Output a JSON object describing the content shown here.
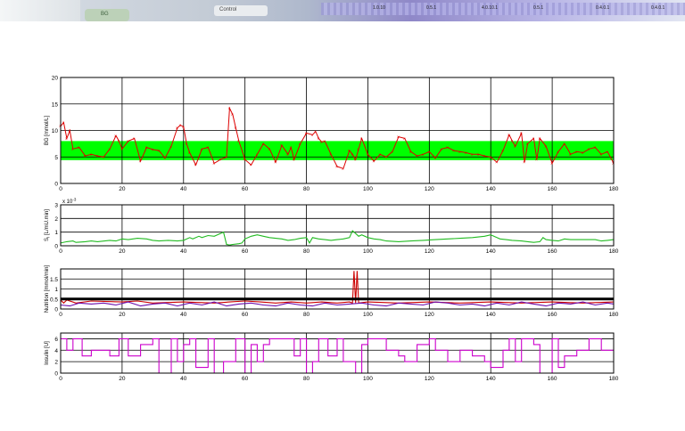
{
  "colors": {
    "background": "#ffffff",
    "band": "#00ff00",
    "bg_series": "#dd0000",
    "si_series": "#22bb22",
    "nutrition_series": "#cc0000",
    "nutrition_series2": "#6a0dad",
    "insulin_series": "#cc00cc",
    "axis": "#000000"
  },
  "banner": {
    "tile_text": "BG",
    "tile2_text": "Control",
    "strip_labels": [
      "1.0.10",
      "0.5.1",
      "4.0.10.1",
      "0.5.1",
      "0.4.0.1",
      "0.4.0.1"
    ]
  },
  "chart_data": [
    {
      "type": "line",
      "ylabel": "BG [mmol/L]",
      "xlim": [
        0,
        180
      ],
      "ylim": [
        0,
        20
      ],
      "xticks": [
        "0",
        "20",
        "40",
        "60",
        "80",
        "100",
        "120",
        "140",
        "160",
        "180"
      ],
      "yticks": [
        "0",
        "5",
        "10",
        "15",
        "20"
      ],
      "band": [
        4.4,
        8.0
      ],
      "series": [
        {
          "x": [
            0,
            1,
            2,
            3,
            4,
            6,
            8,
            10,
            12,
            14,
            16,
            18,
            19,
            20,
            22,
            24,
            26,
            28,
            30,
            32,
            34,
            36,
            38,
            39,
            40,
            41,
            42,
            44,
            46,
            48,
            50,
            52,
            54,
            55,
            56,
            57,
            58,
            60,
            62,
            64,
            66,
            68,
            70,
            72,
            74,
            75,
            76,
            78,
            80,
            82,
            83,
            84,
            85,
            86,
            88,
            90,
            92,
            94,
            95,
            96,
            97,
            98,
            100,
            102,
            104,
            106,
            108,
            110,
            112,
            114,
            116,
            118,
            120,
            122,
            124,
            126,
            128,
            130,
            132,
            134,
            136,
            138,
            140,
            142,
            144,
            146,
            147,
            148,
            150,
            151,
            152,
            154,
            155,
            156,
            158,
            160,
            162,
            164,
            166,
            168,
            170,
            172,
            174,
            176,
            178,
            180
          ],
          "y": [
            10.8,
            11.5,
            8.5,
            10,
            6.5,
            6.8,
            5.2,
            5.5,
            5.2,
            5.0,
            6.5,
            9.0,
            8.0,
            6.5,
            8.0,
            8.5,
            4.2,
            6.8,
            6.4,
            6.2,
            4.8,
            7.0,
            10.5,
            11.0,
            10.7,
            7.5,
            5.8,
            3.5,
            6.5,
            6.8,
            3.8,
            4.5,
            5.0,
            14.2,
            13.0,
            10.5,
            8.0,
            4.5,
            3.5,
            5.5,
            7.5,
            6.5,
            4.0,
            7.2,
            5.5,
            6.8,
            4.5,
            7.5,
            9.5,
            9.2,
            9.8,
            8.5,
            7.8,
            8.0,
            5.5,
            3.2,
            2.8,
            6.2,
            5.5,
            4.5,
            6.5,
            8.5,
            5.5,
            4.2,
            5.5,
            5.0,
            6.0,
            8.8,
            8.5,
            6.0,
            5.2,
            5.5,
            6.0,
            4.8,
            6.5,
            6.8,
            6.2,
            6.0,
            5.8,
            5.5,
            5.5,
            5.2,
            5.0,
            4.0,
            6.2,
            9.2,
            8.0,
            7.0,
            9.5,
            4.0,
            7.5,
            8.5,
            4.5,
            8.5,
            7.0,
            3.8,
            6.0,
            7.5,
            5.5,
            6.0,
            5.8,
            6.5,
            6.8,
            5.5,
            6.0,
            3.8
          ]
        }
      ]
    },
    {
      "type": "line",
      "ylabel": "S",
      "ylabel_sub": "I",
      "ylabel_rest": " [L/mU.min]",
      "exponent": "x 10",
      "exponent_power": "-3",
      "xlim": [
        0,
        180
      ],
      "ylim": [
        0,
        3
      ],
      "xticks": [
        "0",
        "20",
        "40",
        "60",
        "80",
        "100",
        "120",
        "140",
        "160",
        "180"
      ],
      "yticks": [
        "0",
        "1",
        "2",
        "3"
      ],
      "series": [
        {
          "x": [
            0,
            2,
            4,
            5,
            8,
            10,
            12,
            16,
            18,
            20,
            22,
            25,
            28,
            30,
            32,
            35,
            38,
            40,
            42,
            43,
            45,
            46,
            48,
            50,
            51,
            52,
            53,
            54,
            55,
            56,
            58,
            59,
            60,
            62,
            64,
            66,
            68,
            72,
            74,
            76,
            78,
            80,
            81,
            82,
            84,
            86,
            88,
            90,
            92,
            94,
            95,
            96,
            97,
            98,
            100,
            102,
            104,
            106,
            110,
            114,
            118,
            122,
            126,
            130,
            134,
            138,
            140,
            142,
            143,
            145,
            147,
            150,
            152,
            154,
            156,
            157,
            158,
            160,
            162,
            164,
            166,
            170,
            174,
            176,
            178,
            180
          ],
          "y": [
            0.2,
            0.3,
            0.35,
            0.25,
            0.3,
            0.35,
            0.3,
            0.4,
            0.35,
            0.5,
            0.45,
            0.55,
            0.5,
            0.4,
            0.35,
            0.4,
            0.35,
            0.4,
            0.6,
            0.5,
            0.7,
            0.6,
            0.75,
            0.7,
            0.8,
            0.9,
            1.0,
            0.1,
            0.05,
            0.1,
            0.15,
            0.2,
            0.5,
            0.7,
            0.8,
            0.7,
            0.6,
            0.5,
            0.4,
            0.45,
            0.55,
            0.6,
            0.2,
            0.6,
            0.5,
            0.45,
            0.4,
            0.45,
            0.5,
            0.6,
            1.1,
            0.9,
            0.7,
            0.8,
            0.6,
            0.5,
            0.45,
            0.35,
            0.3,
            0.35,
            0.4,
            0.45,
            0.5,
            0.55,
            0.6,
            0.7,
            0.8,
            0.6,
            0.5,
            0.45,
            0.4,
            0.35,
            0.3,
            0.25,
            0.3,
            0.6,
            0.45,
            0.4,
            0.35,
            0.5,
            0.45,
            0.45,
            0.45,
            0.35,
            0.4,
            0.45
          ]
        }
      ]
    },
    {
      "type": "line",
      "ylabel": "Nutrition [mmol/min]",
      "xlim": [
        0,
        180
      ],
      "ylim": [
        0,
        2
      ],
      "xticks": [
        "0",
        "20",
        "40",
        "60",
        "80",
        "100",
        "120",
        "140",
        "160",
        "180"
      ],
      "yticks": [
        "0",
        "0.5",
        "1",
        "1.5"
      ],
      "series": [
        {
          "name": "",
          "x": [
            0,
            1,
            2,
            5,
            10,
            20,
            25,
            30,
            40,
            50,
            55,
            60,
            65,
            70,
            75,
            80,
            85,
            90,
            94,
            95,
            95.5,
            96,
            96.5,
            97,
            100,
            110,
            120,
            130,
            140,
            150,
            160,
            170,
            180
          ],
          "y": [
            0.45,
            0.3,
            0.45,
            0.3,
            0.4,
            0.35,
            0.4,
            0.3,
            0.35,
            0.3,
            0.35,
            0.4,
            0.35,
            0.3,
            0.35,
            0.3,
            0.35,
            0.3,
            0.35,
            0.3,
            1.9,
            0.3,
            1.9,
            0.3,
            0.35,
            0.3,
            0.35,
            0.3,
            0.35,
            0.3,
            0.35,
            0.3,
            0.35
          ]
        },
        {
          "name": "",
          "x": [
            0,
            3,
            6,
            10,
            14,
            18,
            22,
            26,
            30,
            34,
            38,
            42,
            46,
            50,
            54,
            58,
            62,
            66,
            70,
            74,
            78,
            82,
            86,
            90,
            94,
            98,
            102,
            106,
            110,
            114,
            118,
            122,
            126,
            130,
            134,
            138,
            142,
            146,
            150,
            154,
            158,
            162,
            166,
            170,
            174,
            178,
            180
          ],
          "y": [
            0.2,
            0.15,
            0.3,
            0.25,
            0.3,
            0.2,
            0.35,
            0.15,
            0.25,
            0.3,
            0.15,
            0.3,
            0.2,
            0.35,
            0.15,
            0.25,
            0.3,
            0.2,
            0.15,
            0.3,
            0.2,
            0.15,
            0.3,
            0.2,
            0.25,
            0.3,
            0.2,
            0.15,
            0.3,
            0.25,
            0.2,
            0.35,
            0.3,
            0.2,
            0.25,
            0.15,
            0.3,
            0.2,
            0.35,
            0.25,
            0.15,
            0.3,
            0.25,
            0.35,
            0.2,
            0.3,
            0.25
          ]
        }
      ],
      "hline": 0.5
    },
    {
      "type": "line",
      "ylabel": "Insulin [U]",
      "xlim": [
        0,
        180
      ],
      "ylim": [
        0,
        7
      ],
      "xticks": [
        "0",
        "20",
        "40",
        "60",
        "80",
        "100",
        "120",
        "140",
        "160",
        "180"
      ],
      "yticks": [
        "0",
        "2",
        "4",
        "6"
      ],
      "series": [
        {
          "x": [
            0,
            2,
            2,
            4,
            4,
            7,
            7,
            10,
            10,
            16,
            16,
            19,
            19,
            22,
            22,
            26,
            26,
            30,
            30,
            32,
            32,
            36,
            36,
            38,
            38,
            40,
            40,
            42,
            42,
            44,
            44,
            48,
            48,
            50,
            50,
            53,
            53,
            57,
            57,
            60,
            60,
            62,
            62,
            64,
            64,
            66,
            66,
            68,
            68,
            76,
            76,
            78,
            78,
            80,
            80,
            82,
            82,
            84,
            84,
            87,
            87,
            90,
            90,
            92,
            92,
            96,
            96,
            98,
            98,
            100,
            100,
            106,
            106,
            110,
            110,
            112,
            112,
            116,
            116,
            120,
            120,
            122,
            122,
            126,
            126,
            130,
            130,
            134,
            134,
            138,
            138,
            140,
            140,
            144,
            144,
            146,
            146,
            148,
            148,
            150,
            150,
            154,
            154,
            156,
            156,
            160,
            160,
            162,
            162,
            164,
            164,
            168,
            168,
            172,
            172,
            176,
            176,
            180
          ],
          "y": [
            6,
            6,
            4,
            4,
            6,
            6,
            3,
            3,
            4,
            4,
            3,
            3,
            6,
            6,
            3,
            3,
            5,
            5,
            6,
            6,
            0,
            0,
            6,
            6,
            2,
            2,
            5,
            5,
            6,
            6,
            1,
            1,
            6,
            6,
            0,
            0,
            2,
            2,
            6,
            6,
            0,
            0,
            5,
            5,
            2,
            2,
            5,
            5,
            6,
            6,
            3,
            3,
            6,
            6,
            0,
            0,
            2,
            2,
            6,
            6,
            3,
            3,
            6,
            6,
            2,
            2,
            0,
            0,
            5,
            5,
            6,
            6,
            4,
            4,
            3,
            3,
            2,
            2,
            5,
            5,
            6,
            6,
            4,
            4,
            2,
            2,
            4,
            4,
            3,
            3,
            2,
            2,
            1,
            1,
            4,
            4,
            6,
            6,
            2,
            2,
            6,
            6,
            5,
            5,
            0,
            0,
            6,
            6,
            1,
            1,
            3,
            3,
            4,
            4,
            6,
            6,
            4,
            4
          ]
        }
      ]
    }
  ]
}
